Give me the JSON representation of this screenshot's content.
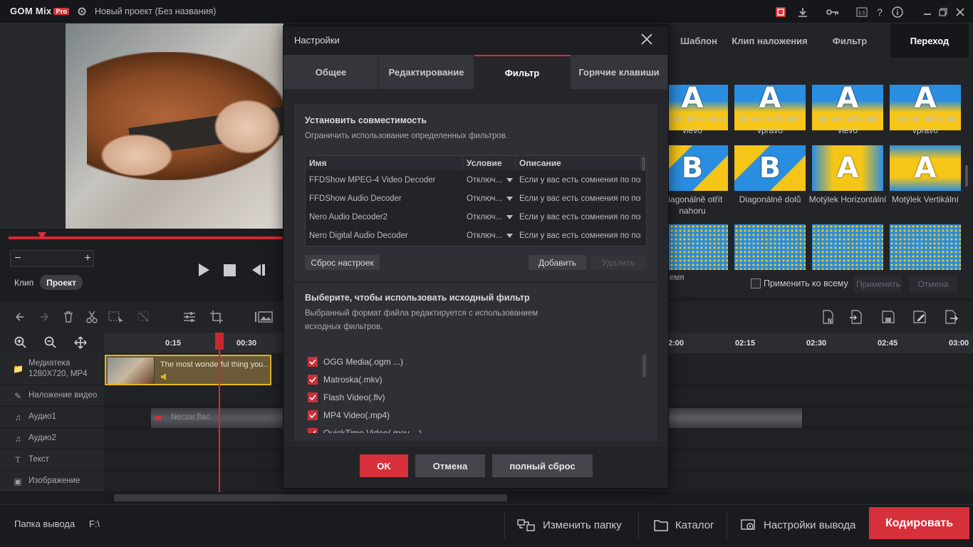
{
  "app": {
    "logo_text": "GOM Mix",
    "logo_badge": "Pro",
    "project_title": "Новый проект (Без названия)"
  },
  "player": {
    "clip_label": "Клип",
    "project_label": "Проект",
    "zoom_minus": "−",
    "zoom_plus": "+"
  },
  "right_tabs": [
    {
      "label": "Шаблон"
    },
    {
      "label": "Клип наложения"
    },
    {
      "label": "Фильтр"
    },
    {
      "label": "Переход",
      "active": true
    }
  ],
  "transitions": [
    {
      "label": "Jemně otřít nahoru vlevo",
      "glyph": "A"
    },
    {
      "label": "Jemně otřít dolů vpravo",
      "glyph": "A"
    },
    {
      "label": "Jemně otřít dolů vlevo",
      "glyph": "A"
    },
    {
      "label": "Jemně otřít dolů vpravo",
      "glyph": "A"
    },
    {
      "label": "Diagonálně otřít nahoru",
      "glyph": "B"
    },
    {
      "label": "Diagonálně dolů",
      "glyph": "B"
    },
    {
      "label": "Motýlek Horizontální",
      "glyph": "A"
    },
    {
      "label": "Motýlek Vertikální",
      "glyph": "A"
    }
  ],
  "right_footer": {
    "partial_label": "емя",
    "apply_all": "Применить ко всему",
    "apply": "Применить",
    "cancel": "Отмена"
  },
  "ruler": {
    "ticks": [
      "0:15",
      "00:30",
      "2:00",
      "02:15",
      "02:30",
      "02:45",
      "03:00"
    ]
  },
  "tracks": [
    {
      "label": "Медиатека",
      "sub": "1280X720, MP4"
    },
    {
      "label": "Наложение видео"
    },
    {
      "label": "Аудио1"
    },
    {
      "label": "Аудио2"
    },
    {
      "label": "Текст"
    },
    {
      "label": "Изображение"
    }
  ],
  "media_clip": {
    "title": "The most wonderful thing you..."
  },
  "audio_clip": {
    "title": "Nectar.flac"
  },
  "bottom": {
    "output_folder_label": "Папка вывода",
    "output_folder_value": "F:\\",
    "change_folder": "Изменить папку",
    "catalog": "Каталог",
    "output_settings": "Настройки вывода",
    "encode": "Кодировать"
  },
  "dialog": {
    "title": "Настройки",
    "tabs": [
      {
        "label": "Общее"
      },
      {
        "label": "Редактирование"
      },
      {
        "label": "Фильтр",
        "active": true
      },
      {
        "label": "Горячие клавиши"
      }
    ],
    "compat": {
      "title": "Установить совместимость",
      "desc": "Ограничить использование определенных фильтров.",
      "columns": [
        "Имя",
        "Условие",
        "Описание"
      ],
      "rows": [
        {
          "name": "FFDShow MPEG-4 Video Decoder",
          "cond": "Отключ...",
          "desc": "Если у вас есть сомнения по пов"
        },
        {
          "name": "FFDShow Audio Decoder",
          "cond": "Отключ...",
          "desc": "Если у вас есть сомнения по пов"
        },
        {
          "name": "Nero Audio Decoder2",
          "cond": "Отключ...",
          "desc": "Если у вас есть сомнения по пов"
        },
        {
          "name": "Nero Digital Audio Decoder",
          "cond": "Отключ...",
          "desc": "Если у вас есть сомнения по пов"
        }
      ],
      "reset": "Сброс настроек",
      "add": "Добавить",
      "delete": "Удалить"
    },
    "source": {
      "title": "Выберите, чтобы использовать исходный фильтр",
      "desc_line1": "Выбранный формат файла редактируется с использованием",
      "desc_line2": "исходных фильтров.",
      "formats": [
        {
          "label": "OGG Media(.ogm ...)",
          "checked": true
        },
        {
          "label": "Matroska(.mkv)",
          "checked": true
        },
        {
          "label": "Flash Video(.flv)",
          "checked": true
        },
        {
          "label": "MP4 Video(.mp4)",
          "checked": true
        },
        {
          "label": "QuickTime Video(.mov ...)",
          "checked": true
        }
      ]
    },
    "ok": "OK",
    "cancel": "Отмена",
    "full_reset": "полный сброс"
  },
  "colors": {
    "accent": "#d6303a",
    "clip_border": "#e8b41a",
    "transition_yellow": "#f5c518",
    "transition_blue": "#2a8ee0"
  }
}
